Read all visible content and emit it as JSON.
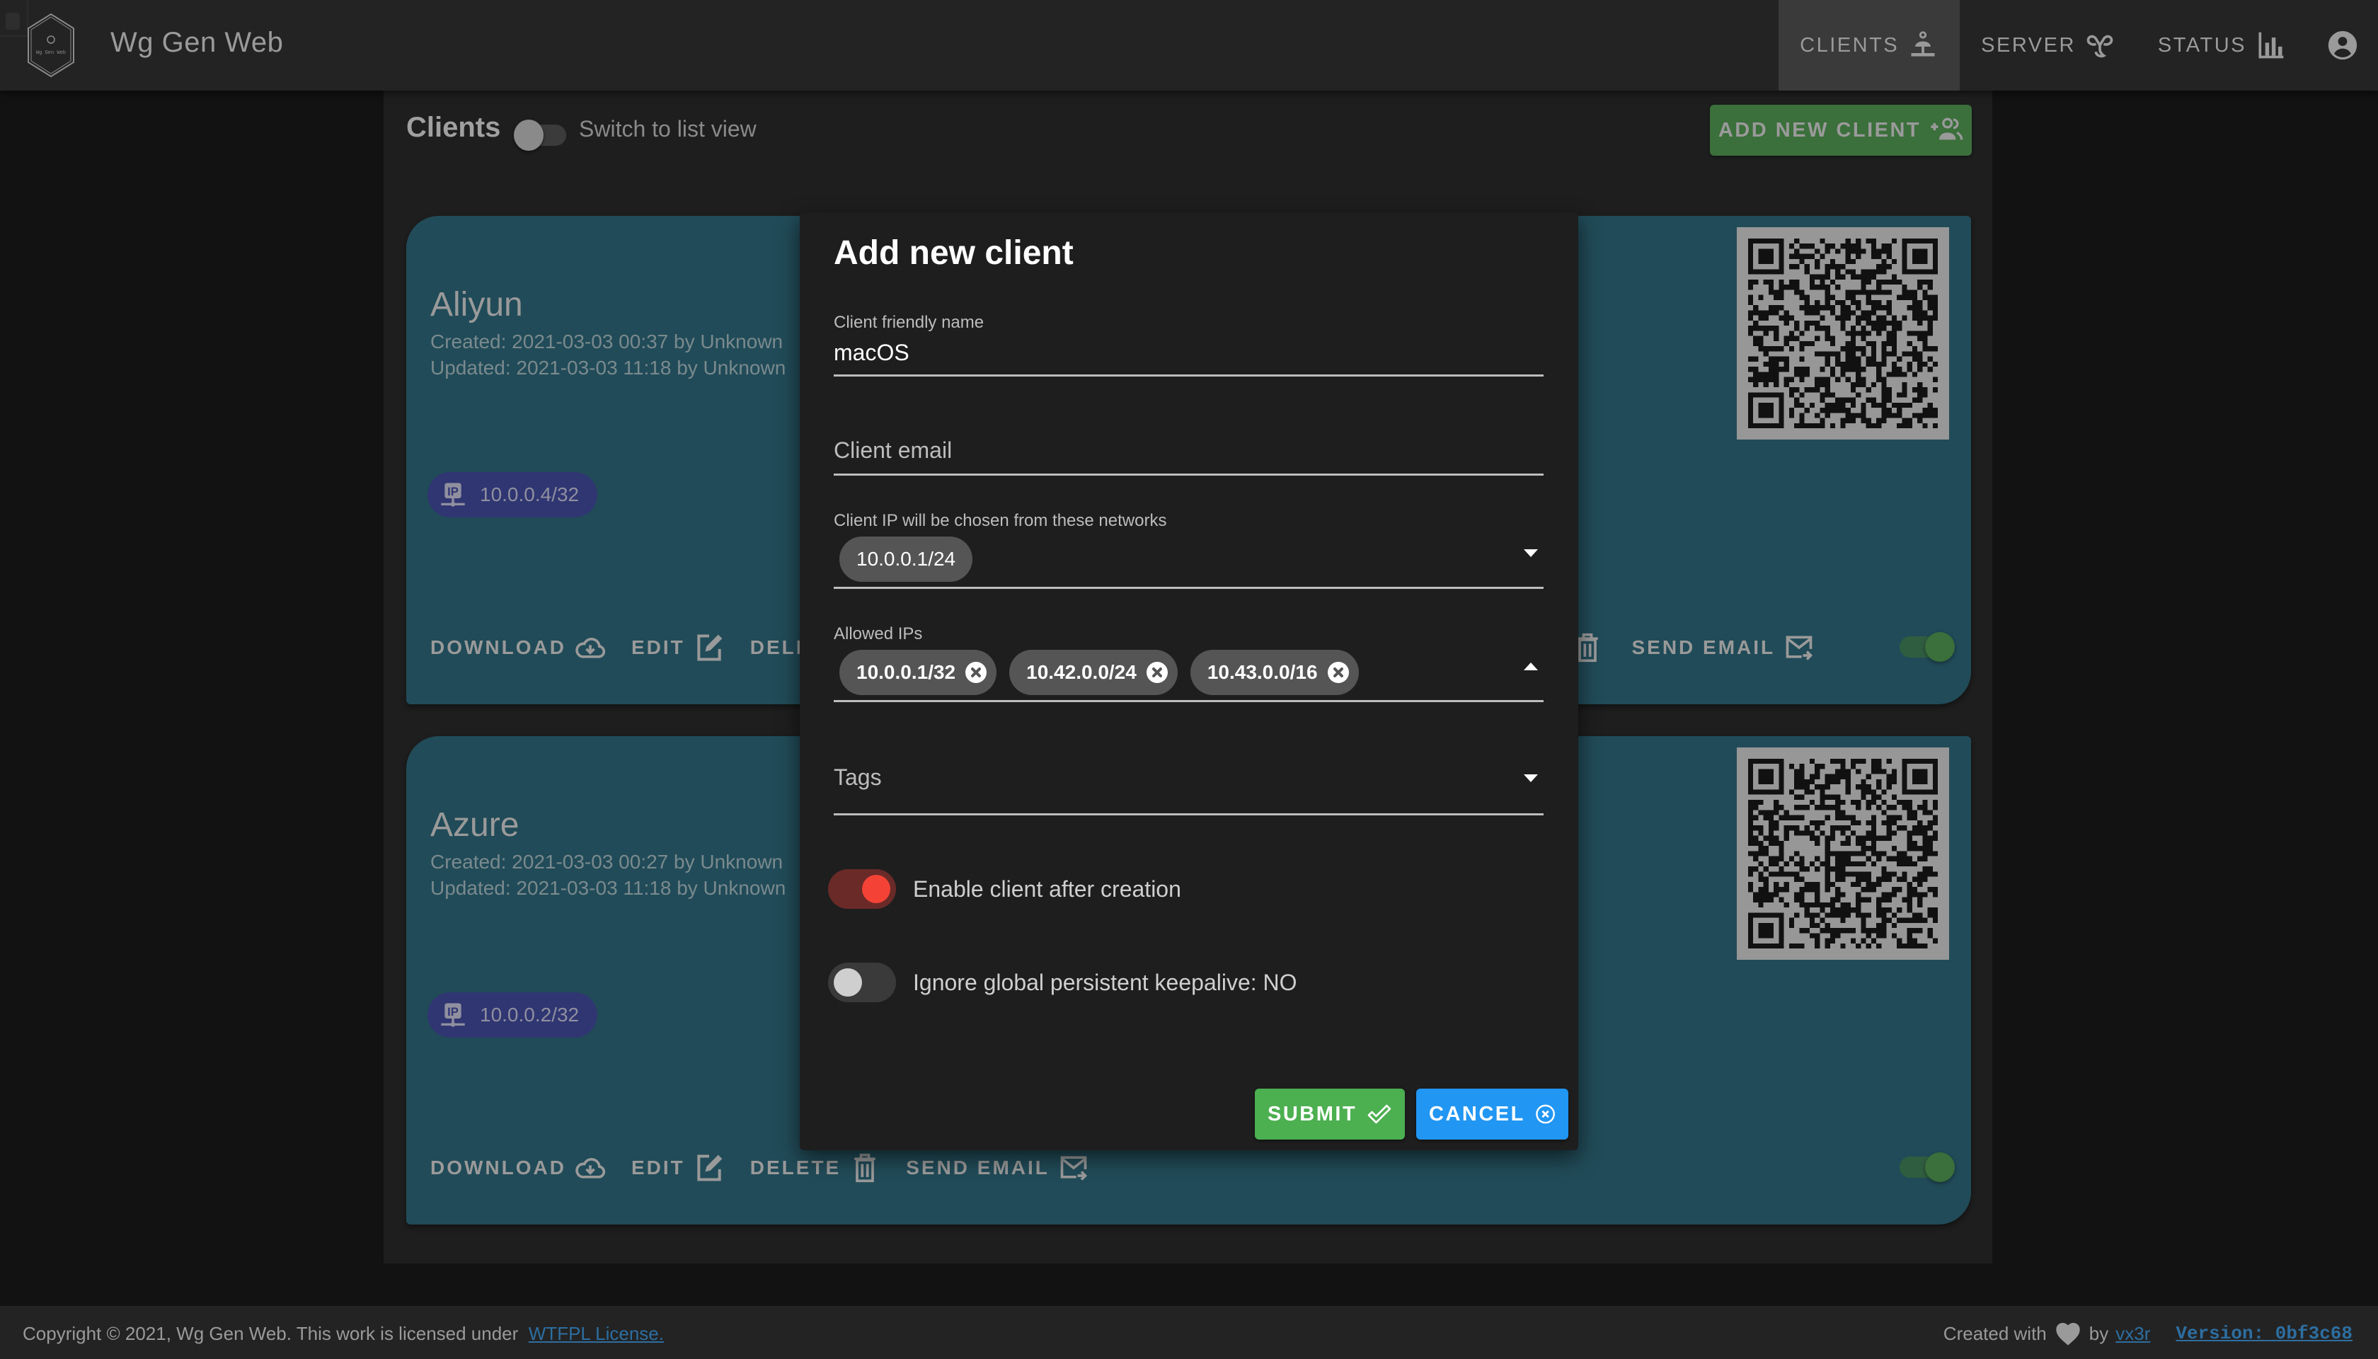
{
  "app": {
    "title": "Wg Gen Web",
    "logo_text": "Wg Gen Web"
  },
  "nav": {
    "items": [
      {
        "label": "CLIENTS",
        "icon": "lan-icon",
        "active": true
      },
      {
        "label": "SERVER",
        "icon": "vpn-icon",
        "active": false
      },
      {
        "label": "STATUS",
        "icon": "bar-chart-icon",
        "active": false
      }
    ],
    "account_icon": "account-circle-icon"
  },
  "clients_page": {
    "title": "Clients",
    "list_view_switch": {
      "label": "Switch to list view",
      "on": false
    },
    "add_button_label": "ADD NEW CLIENT"
  },
  "clients": [
    {
      "name": "Aliyun",
      "created": "Created: 2021-03-03 00:37 by Unknown",
      "updated": "Updated: 2021-03-03 11:18 by Unknown",
      "address": "10.0.0.4/32",
      "enabled": true
    },
    {
      "name": "Azure",
      "created": "Created: 2021-03-03 00:27 by Unknown",
      "updated": "Updated: 2021-03-03 11:18 by Unknown",
      "address": "10.0.0.2/32",
      "enabled": true
    }
  ],
  "card_actions": {
    "download": "DOWNLOAD",
    "edit": "EDIT",
    "delete": "DELETE",
    "delete_partial_left": "DELET",
    "delete_partial_right": "ETE",
    "send_email": "SEND EMAIL"
  },
  "dialog": {
    "title": "Add new client",
    "name_field": {
      "label": "Client friendly name",
      "value": "macOS"
    },
    "email_field": {
      "label": "Client email",
      "value": ""
    },
    "networks_field": {
      "label": "Client IP will be chosen from these networks",
      "chips": [
        "10.0.0.1/24"
      ]
    },
    "allowed_ips_field": {
      "label": "Allowed IPs",
      "chips": [
        "10.0.0.1/32",
        "10.42.0.0/24",
        "10.43.0.0/16"
      ]
    },
    "tags_field": {
      "label": "Tags"
    },
    "enable_switch": {
      "label": "Enable client after creation",
      "on": true
    },
    "keepalive_switch": {
      "label": "Ignore global persistent keepalive: NO",
      "on": false
    },
    "submit_label": "SUBMIT",
    "cancel_label": "CANCEL"
  },
  "footer": {
    "copyright": "Copyright © 2021, Wg Gen Web. This work is licensed under",
    "license_link": "WTFPL License.",
    "created_with": "Created with",
    "by": "by",
    "author_link": "vx3r",
    "version": "Version: 0bf3c68"
  },
  "colors": {
    "appbar": "#232323",
    "card": "#214b58",
    "ip_chip": "#303672",
    "add_button": "#3b6f3b",
    "submit": "#4caf50",
    "cancel": "#2196f3",
    "enable_switch": "#f44336",
    "link": "#2d6ea0"
  }
}
